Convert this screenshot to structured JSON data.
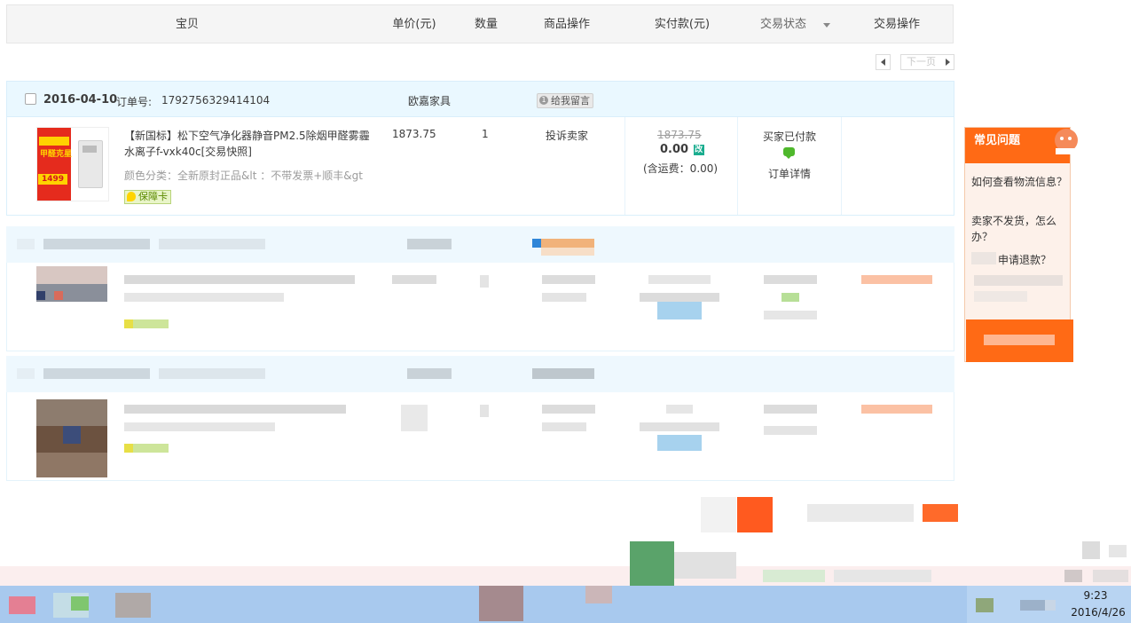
{
  "header": {
    "columns": {
      "item": "宝贝",
      "unit_price": "单价(元)",
      "quantity": "数量",
      "item_ops": "商品操作",
      "paid": "实付款(元)",
      "status": "交易状态",
      "trade_ops": "交易操作"
    }
  },
  "pagination_top": {
    "next_label": "下一页"
  },
  "order": {
    "date": "2016-04-10",
    "order_no_label": "订单号:",
    "order_no": "1792756329414104",
    "shop": "欧嘉家具",
    "message_button": "给我留言",
    "message_count": "1",
    "item": {
      "title_line1": "【新国标】松下空气净化器静音PM2.5除烟甲醛雾霾",
      "title_line2": "水离子f-vxk40c[交易快照]",
      "sku": "颜色分类：全新原封正品&lt ：不带发票+顺丰&gt",
      "guarantee": "保障卡",
      "image_banner": "甲醛克星",
      "image_price": "1499",
      "unit_price": "1873.75",
      "quantity": "1",
      "item_op": "投诉卖家",
      "original_total": "1873.75",
      "paid_total": "0.00",
      "pay_badge": "改",
      "shipping": "(含运费：0.00)",
      "status": "买家已付款",
      "detail_link": "订单详情"
    }
  },
  "faq": {
    "title": "常见问题",
    "items": [
      "如何查看物流信息？",
      "卖家不发货，怎么办？",
      "申请退款？"
    ]
  },
  "taskbar": {
    "time": "9:23",
    "date": "2016/4/26"
  },
  "colors": {
    "accent_orange": "#ff6a15",
    "order_header_bg": "#eaf8ff",
    "taskbar_bg": "#a8c9ee"
  }
}
